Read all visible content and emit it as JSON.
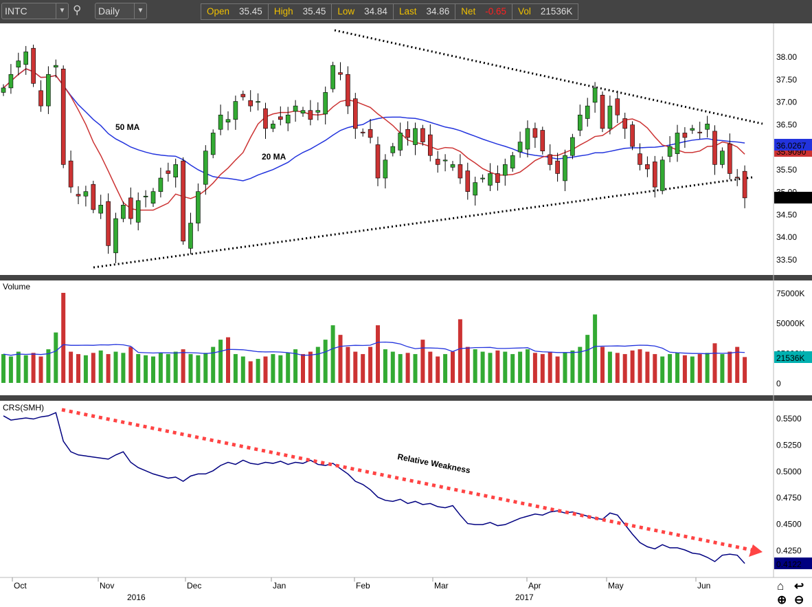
{
  "toolbar": {
    "symbol": "INTC",
    "period": "Daily",
    "quote": [
      {
        "label": "Open",
        "value": "35.45"
      },
      {
        "label": "High",
        "value": "35.45"
      },
      {
        "label": "Low",
        "value": "34.84"
      },
      {
        "label": "Last",
        "value": "34.86"
      },
      {
        "label": "Net",
        "value": "-0.65"
      },
      {
        "label": "Vol",
        "value": "21536K"
      }
    ]
  },
  "colors": {
    "up": "#33aa33",
    "down": "#cc3333",
    "ma20": "#cc3333",
    "ma50": "#2233dd",
    "crs": "#000080",
    "net": "#ff2020",
    "annotation": "#ff4444"
  },
  "price_panel": {
    "ma20_label": "20 MA",
    "ma50_label": "50 MA",
    "ma50_value": "36.0267",
    "ma20_value": "35.9090",
    "last_value": "34.86",
    "ticks": [
      "38.00",
      "37.50",
      "37.00",
      "36.50",
      "36.00",
      "35.50",
      "35.00",
      "34.50",
      "34.00",
      "33.50"
    ],
    "closes": [
      37.3,
      37.6,
      37.9,
      38.1,
      37.4,
      36.9,
      37.6,
      37.8,
      35.6,
      35.1,
      34.9,
      35.0,
      34.6,
      34.7,
      33.8,
      34.4,
      34.7,
      34.4,
      34.8,
      34.9,
      35.0,
      35.3,
      35.4,
      35.6,
      33.9,
      34.3,
      35.0,
      35.9,
      36.3,
      36.7,
      36.6,
      37.0,
      37.1,
      36.9,
      37.0,
      36.4,
      36.5,
      36.6,
      36.7,
      36.9,
      36.8,
      36.6,
      36.8,
      37.2,
      37.8,
      37.6,
      36.9,
      36.4,
      36.3,
      36.2,
      35.3,
      35.7,
      36.0,
      36.3,
      36.2,
      36.4,
      36.1,
      35.8,
      35.6,
      35.7,
      35.6,
      35.3,
      35.0,
      35.2,
      35.3,
      35.4,
      35.2,
      35.6,
      35.8,
      36.1,
      36.4,
      36.2,
      35.9,
      35.6,
      35.4,
      35.8,
      36.2,
      36.7,
      36.9,
      37.3,
      36.4,
      36.9,
      36.7,
      36.4,
      36.0,
      35.6,
      35.5,
      35.1,
      35.7,
      36.0,
      36.3,
      36.2,
      36.4,
      36.3,
      36.5,
      35.6,
      35.9,
      35.4,
      35.3,
      34.86
    ]
  },
  "volume_panel": {
    "label": "Volume",
    "ticks": [
      "75000K",
      "50000K",
      "25000K",
      "0"
    ],
    "last_value": "21536K",
    "values": [
      24000,
      22000,
      26000,
      23000,
      25000,
      22000,
      28000,
      42000,
      75000,
      26000,
      24000,
      23000,
      25000,
      27000,
      24000,
      26000,
      25000,
      30000,
      24000,
      23000,
      22000,
      25000,
      24000,
      26000,
      28000,
      24000,
      23000,
      25000,
      30000,
      36000,
      38000,
      24000,
      22000,
      18000,
      20000,
      22000,
      24000,
      23000,
      25000,
      28000,
      24000,
      26000,
      30000,
      36000,
      48000,
      40000,
      30000,
      26000,
      24000,
      30000,
      48000,
      28000,
      26000,
      24000,
      25000,
      24000,
      36000,
      26000,
      22000,
      24000,
      26000,
      53000,
      30000,
      28000,
      26000,
      25000,
      27000,
      26000,
      24000,
      26000,
      28000,
      25000,
      24000,
      26000,
      22000,
      25000,
      27000,
      30000,
      40000,
      57000,
      30000,
      26000,
      25000,
      24000,
      27000,
      28000,
      26000,
      24000,
      22000,
      24000,
      25000,
      23000,
      22000,
      24000,
      25000,
      33000,
      24000,
      26000,
      30000,
      21536
    ]
  },
  "crs_panel": {
    "label": "CRS(SMH)",
    "ticks": [
      "0.5500",
      "0.5250",
      "0.5000",
      "0.4750",
      "0.4500",
      "0.4250"
    ],
    "last_value": "0.4122",
    "annotation": "Relative Weakness",
    "values": [
      0.552,
      0.548,
      0.549,
      0.55,
      0.549,
      0.551,
      0.552,
      0.555,
      0.528,
      0.518,
      0.515,
      0.514,
      0.513,
      0.512,
      0.511,
      0.515,
      0.518,
      0.508,
      0.503,
      0.5,
      0.497,
      0.495,
      0.493,
      0.494,
      0.49,
      0.495,
      0.497,
      0.497,
      0.5,
      0.505,
      0.508,
      0.506,
      0.51,
      0.507,
      0.506,
      0.508,
      0.507,
      0.509,
      0.506,
      0.508,
      0.507,
      0.51,
      0.506,
      0.505,
      0.507,
      0.502,
      0.497,
      0.49,
      0.487,
      0.482,
      0.475,
      0.472,
      0.471,
      0.473,
      0.469,
      0.471,
      0.468,
      0.469,
      0.466,
      0.465,
      0.467,
      0.458,
      0.45,
      0.449,
      0.449,
      0.451,
      0.448,
      0.449,
      0.452,
      0.455,
      0.457,
      0.459,
      0.458,
      0.461,
      0.462,
      0.46,
      0.461,
      0.459,
      0.457,
      0.455,
      0.454,
      0.46,
      0.458,
      0.449,
      0.44,
      0.432,
      0.428,
      0.426,
      0.43,
      0.427,
      0.427,
      0.425,
      0.422,
      0.421,
      0.418,
      0.414,
      0.42,
      0.421,
      0.42,
      0.4122
    ]
  },
  "x_axis": {
    "months": [
      "Oct",
      "Nov",
      "Dec",
      "Jan",
      "Feb",
      "Mar",
      "Apr",
      "May",
      "Jun"
    ],
    "years": [
      "2016",
      "2017"
    ]
  },
  "icons": [
    "home-icon",
    "undo-icon",
    "zoom-in-icon",
    "zoom-out-icon"
  ]
}
